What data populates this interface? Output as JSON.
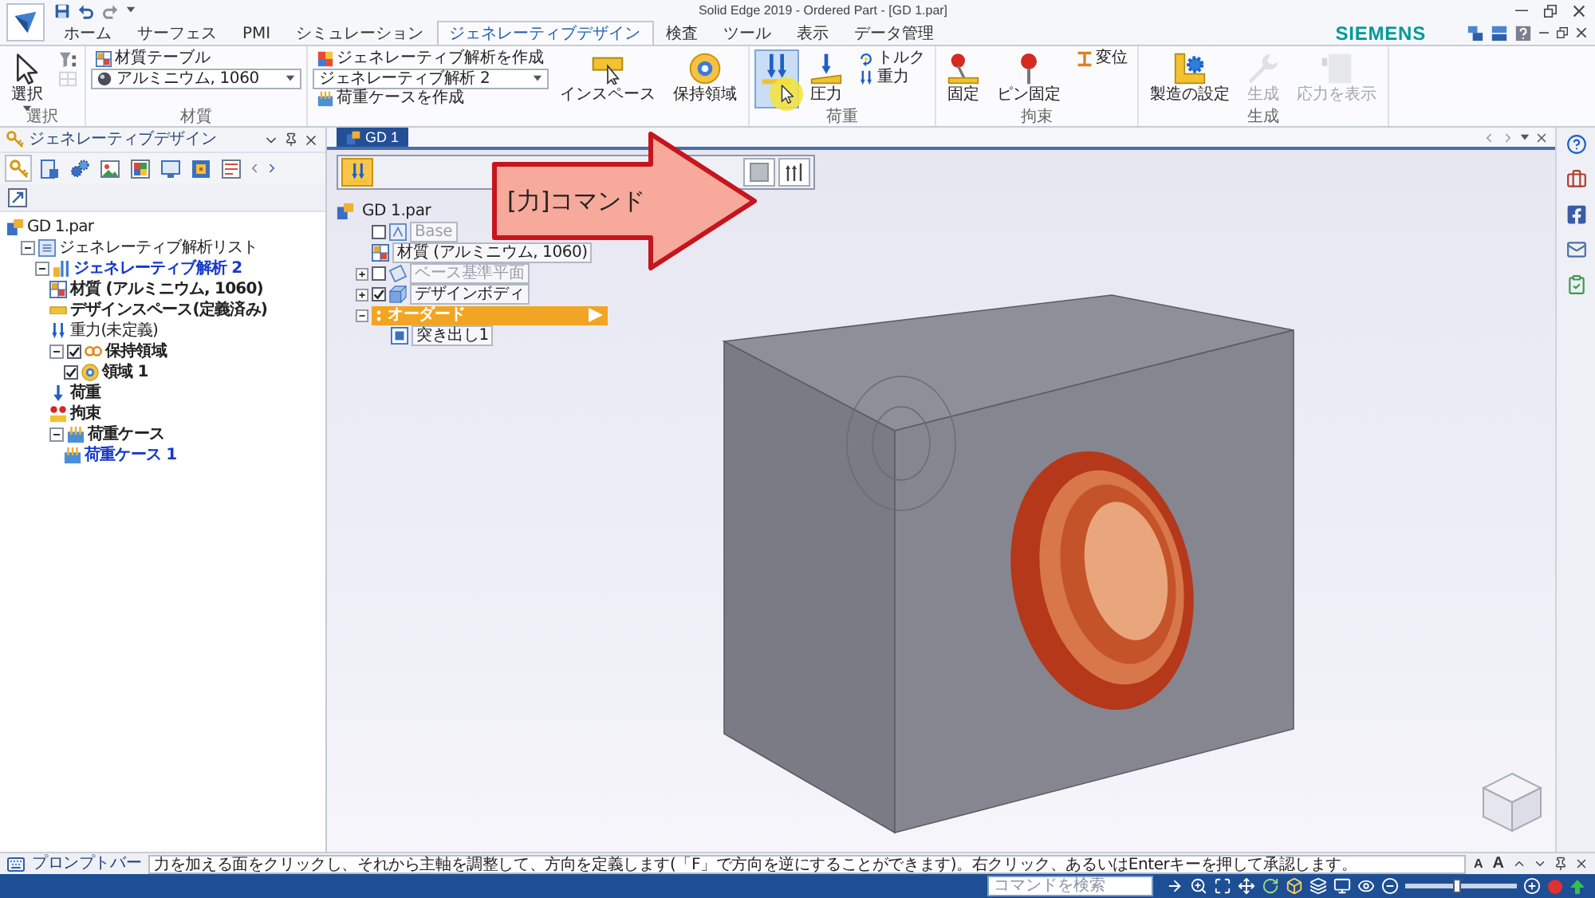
{
  "window": {
    "title": "Solid Edge 2019 - Ordered Part - [GD 1.par]"
  },
  "ribbon_tabs": [
    {
      "label": "ホーム",
      "selected": false
    },
    {
      "label": "サーフェス",
      "selected": false
    },
    {
      "label": "PMI",
      "selected": false
    },
    {
      "label": "シミュレーション",
      "selected": false
    },
    {
      "label": "ジェネレーティブデザイン",
      "selected": true
    },
    {
      "label": "検査",
      "selected": false
    },
    {
      "label": "ツール",
      "selected": false
    },
    {
      "label": "表示",
      "selected": false
    },
    {
      "label": "データ管理",
      "selected": false
    }
  ],
  "brand": "SIEMENS",
  "ribbon_groups": [
    {
      "label": "選択",
      "columns": [
        {
          "items": [
            {
              "kind": "large",
              "label": "選択",
              "menu": true,
              "disabled": false,
              "highlighted": false
            }
          ]
        },
        {
          "items": [
            {
              "kind": "icon",
              "disabled": false,
              "highlighted": false
            },
            {
              "kind": "icon",
              "disabled": true,
              "highlighted": false
            }
          ]
        }
      ]
    },
    {
      "label": "材質",
      "columns": [
        {
          "items": [
            {
              "kind": "small",
              "label": "材質テーブル",
              "disabled": false,
              "highlighted": false
            },
            {
              "kind": "dropdown",
              "value": "アルミニウム, 1060"
            }
          ]
        }
      ]
    },
    {
      "columns": [
        {
          "items": [
            {
              "kind": "small",
              "label": "ジェネレーティブ解析を作成",
              "disabled": false,
              "highlighted": false
            },
            {
              "kind": "dropdown",
              "value": "ジェネレーティブ解析 2"
            },
            {
              "kind": "small",
              "label": "荷重ケースを作成",
              "disabled": false,
              "highlighted": false
            }
          ]
        },
        {
          "items": [
            {
              "kind": "large",
              "label": "インスペース",
              "disabled": false,
              "highlighted": false
            }
          ]
        },
        {
          "items": [
            {
              "kind": "large",
              "label": "保持領域",
              "disabled": false,
              "highlighted": false
            }
          ]
        }
      ]
    },
    {
      "label": "荷重",
      "columns": [
        {
          "items": [
            {
              "kind": "large",
              "disabled": false,
              "highlighted": true
            }
          ]
        },
        {
          "items": [
            {
              "kind": "large",
              "label": "圧力",
              "disabled": false,
              "highlighted": false
            }
          ]
        },
        {
          "items": [
            {
              "kind": "small",
              "label": "トルク",
              "disabled": false,
              "highlighted": false
            },
            {
              "kind": "small",
              "label": "重力",
              "disabled": false,
              "highlighted": false
            }
          ]
        }
      ]
    },
    {
      "label": "拘束",
      "columns": [
        {
          "items": [
            {
              "kind": "large",
              "label": "固定",
              "disabled": false,
              "highlighted": false
            }
          ]
        },
        {
          "items": [
            {
              "kind": "large",
              "label": "ピン固定",
              "disabled": false,
              "highlighted": false
            }
          ]
        },
        {
          "items": [
            {
              "kind": "small",
              "label": "変位",
              "disabled": false,
              "highlighted": false
            }
          ]
        }
      ]
    },
    {
      "label": "生成",
      "columns": [
        {
          "items": [
            {
              "kind": "large",
              "label": "製造の設定",
              "disabled": false,
              "highlighted": false
            }
          ]
        },
        {
          "items": [
            {
              "kind": "large",
              "label": "生成",
              "disabled": true,
              "highlighted": false
            }
          ]
        },
        {
          "items": [
            {
              "kind": "large",
              "label": "応力を表示",
              "disabled": true,
              "highlighted": false
            }
          ]
        }
      ]
    }
  ],
  "side_panel": {
    "title": "ジェネレーティブデザイン",
    "tabs": [
      {
        "selected": true
      },
      {
        "selected": false
      },
      {
        "selected": false
      },
      {
        "selected": false
      },
      {
        "selected": false
      },
      {
        "selected": false
      },
      {
        "selected": false
      },
      {
        "selected": false
      }
    ],
    "tree": [
      {
        "kind": "part",
        "label": "GD 1.par",
        "bold": false,
        "active": false,
        "children": [
          {
            "kind": "list",
            "label": "ジェネレーティブ解析リスト",
            "bold": false,
            "active": false,
            "expanded": true,
            "children": [
              {
                "kind": "analysis",
                "label": "ジェネレーティブ解析 2",
                "bold": true,
                "active": true,
                "expanded": true,
                "children": [
                  {
                    "kind": "material",
                    "label": "材質 (アルミニウム, 1060)",
                    "bold": true,
                    "active": false
                  },
                  {
                    "kind": "space",
                    "label": "デザインスペース(定義済み)",
                    "bold": true,
                    "active": false
                  },
                  {
                    "kind": "gravity",
                    "label": "重力(未定義)",
                    "bold": false,
                    "active": false
                  },
                  {
                    "kind": "retain",
                    "label": "保持領域",
                    "bold": true,
                    "active": false,
                    "expanded": true,
                    "checked": true,
                    "children": [
                      {
                        "kind": "region",
                        "label": "領域 1",
                        "bold": true,
                        "active": false,
                        "checked": true
                      }
                    ]
                  },
                  {
                    "kind": "load",
                    "label": "荷重",
                    "bold": true,
                    "active": false
                  },
                  {
                    "kind": "constraint",
                    "label": "拘束",
                    "bold": true,
                    "active": false
                  },
                  {
                    "kind": "cases",
                    "label": "荷重ケース",
                    "bold": true,
                    "active": false,
                    "expanded": true,
                    "children": [
                      {
                        "kind": "case",
                        "label": "荷重ケース 1",
                        "bold": true,
                        "active": true
                      }
                    ]
                  }
                ]
              }
            ]
          }
        ]
      }
    ]
  },
  "document": {
    "tab": "GD 1",
    "command_bar": [
      {
        "selected": true
      },
      {
        "selected": false
      },
      {
        "selected": false
      }
    ],
    "tree": [
      {
        "kind": "part",
        "label": "GD 1.par",
        "children": [
          {
            "kind": "sketch",
            "label": "Base",
            "checked": false
          },
          {
            "kind": "material",
            "label": "材質 (アルミニウム, 1060)"
          },
          {
            "kind": "planes",
            "label": "ベース基準平面",
            "expanded": false,
            "checked": false
          },
          {
            "kind": "body",
            "label": "デザインボディ",
            "expanded": false,
            "checked": true
          },
          {
            "kind": "section",
            "label": "オーダード",
            "expanded": true,
            "children": [
              {
                "kind": "feature",
                "label": "突き出し1"
              }
            ]
          }
        ]
      }
    ]
  },
  "callout": {
    "text": "[力]コマンド"
  },
  "prompt_bar": {
    "label": "プロンプトバー",
    "message": "力を加える面をクリックし、それから主軸を調整して、方向を定義します(「F」で方向を逆にすることができます)。右クリック、あるいはEnterキーを押して承認します。",
    "font_buttons": [
      "A",
      "A"
    ]
  },
  "status_bar": {
    "search": {
      "placeholder": "コマンドを検索"
    },
    "zoom": {
      "level": 0.45
    }
  }
}
